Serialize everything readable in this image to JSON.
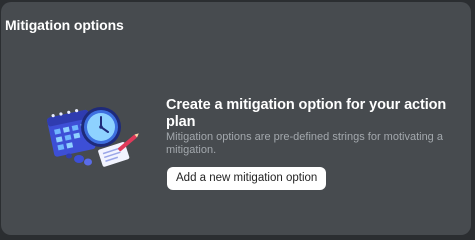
{
  "section": {
    "title": "Mitigation options"
  },
  "empty_state": {
    "illustration": "calendar-clock-illustration-icon",
    "title": "Create a mitigation option for your action plan",
    "description": "Mitigation options are pre-defined strings for motivating a mitigation.",
    "button_label": "Add a new mitigation option"
  },
  "colors": {
    "page_background": "#2b2e31",
    "panel_background": "#474b4f",
    "title_text": "#ffffff",
    "description_text": "#a3a8ad",
    "button_background": "#ffffff",
    "button_text": "#242424",
    "illustration_primary": "#3d4fd6",
    "illustration_accent": "#6fb6ff"
  }
}
